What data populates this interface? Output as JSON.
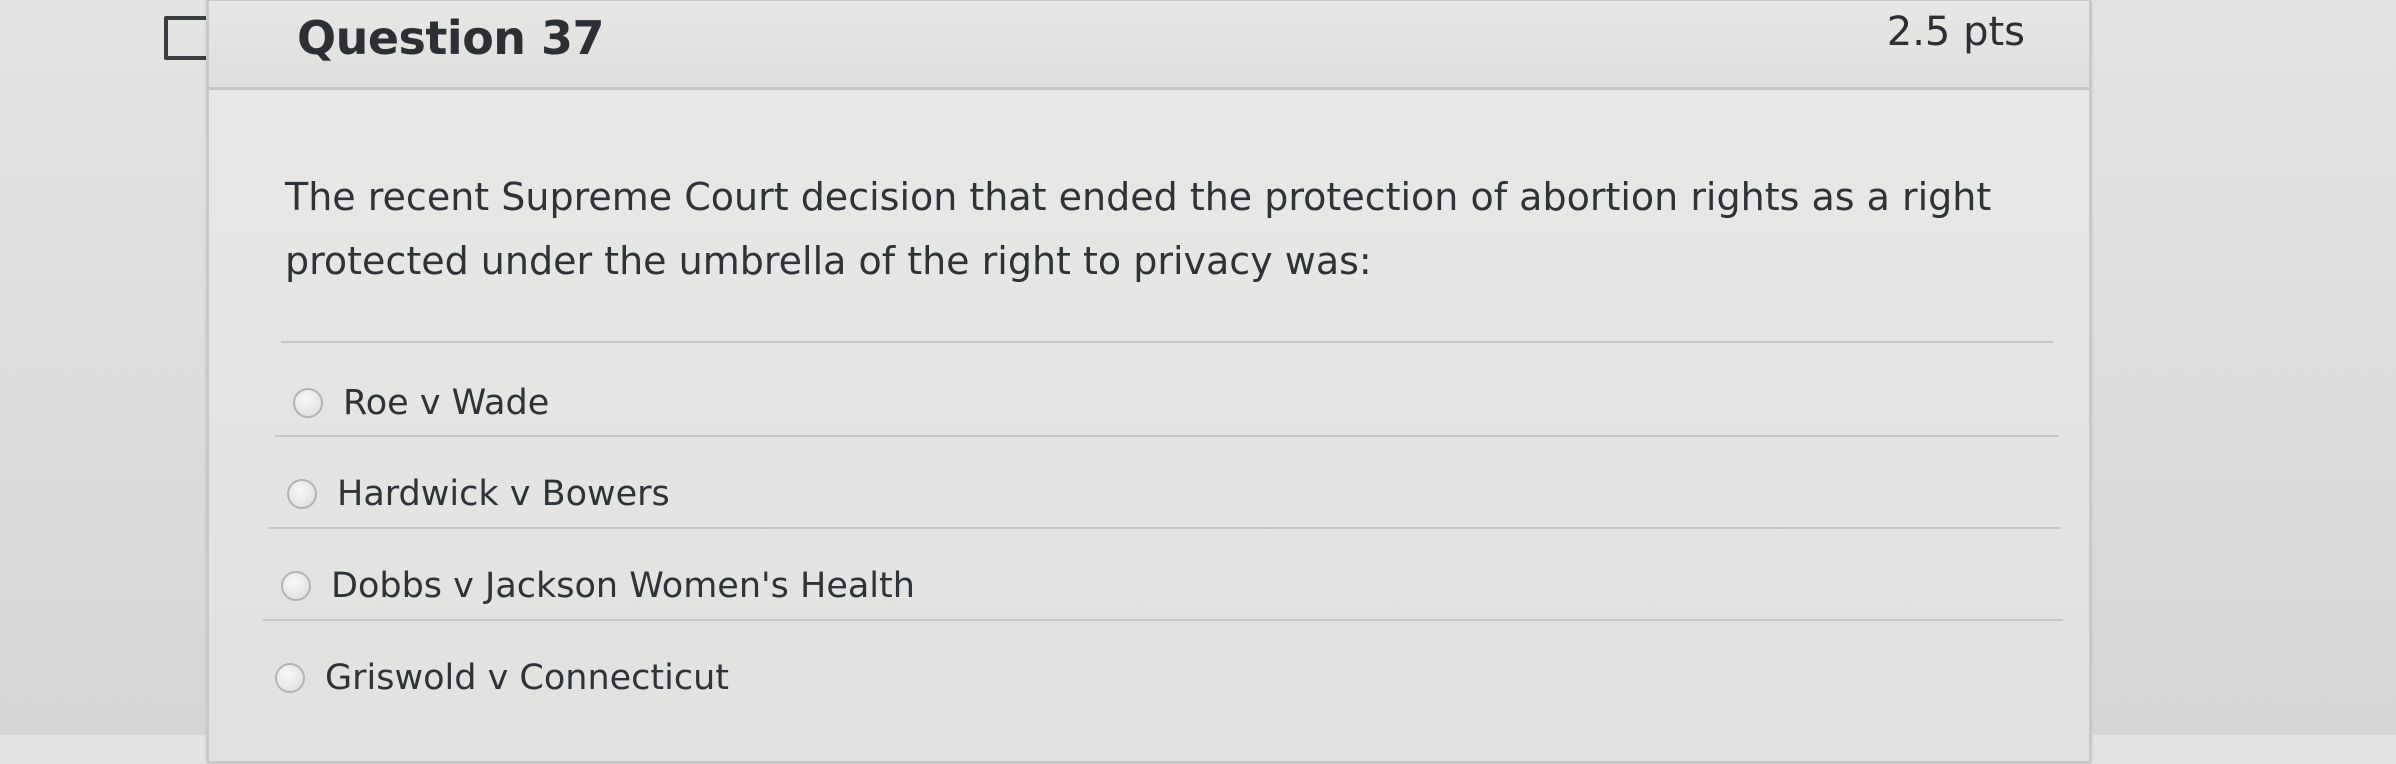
{
  "question": {
    "title": "Question 37",
    "points": "2.5 pts",
    "text": "The recent Supreme Court decision that ended the protection of abortion rights as a right protected under the umbrella of the right to privacy was:",
    "answers": [
      {
        "label": "Roe v Wade",
        "selected": false
      },
      {
        "label": "Hardwick v Bowers",
        "selected": false
      },
      {
        "label": "Dobbs v Jackson Women's Health",
        "selected": false
      },
      {
        "label": "Griswold v Connecticut",
        "selected": false
      }
    ]
  },
  "icons": {
    "flag": "flag-bookmark-icon"
  }
}
